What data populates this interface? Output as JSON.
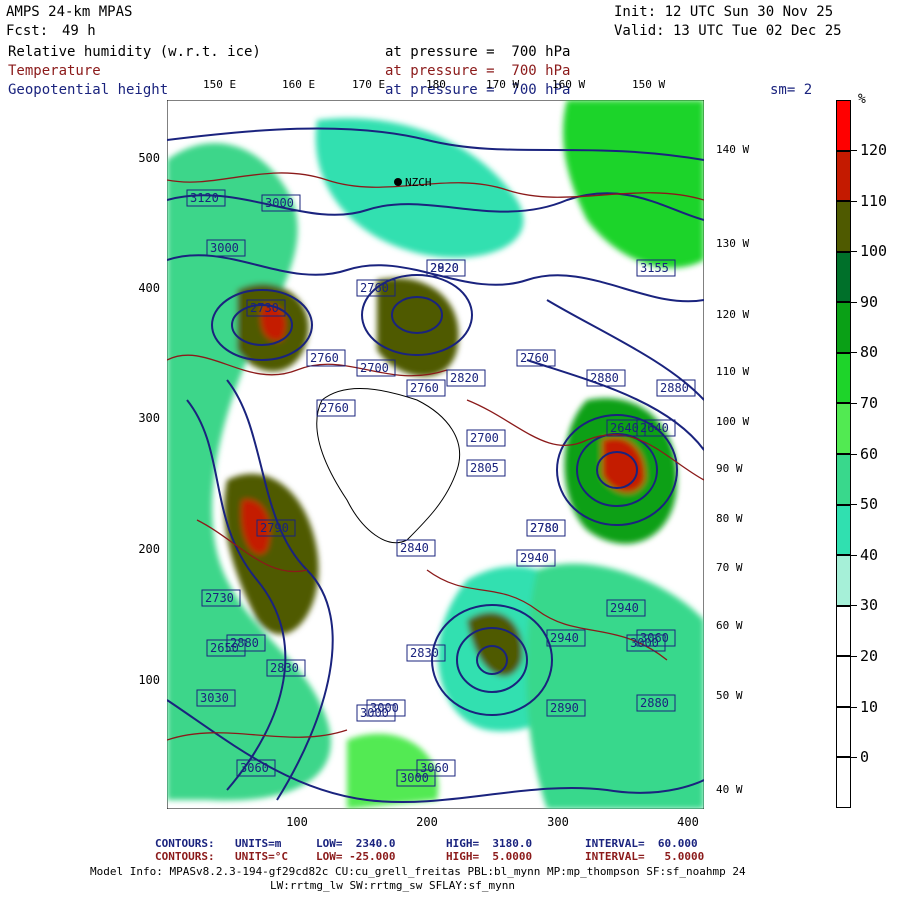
{
  "header": {
    "model": "AMPS 24-km MPAS",
    "init": "Init: 12 UTC Sun 30 Nov 25",
    "fcst_label": "Fcst:",
    "fcst_value": "49 h",
    "valid": "Valid: 13 UTC Tue 02 Dec 25"
  },
  "fields": [
    {
      "name": "Relative humidity (w.r.t. ice)",
      "level": "at pressure =  700 hPa",
      "color": "#000000"
    },
    {
      "name": "Temperature",
      "level": "at pressure =  700 hPa",
      "color": "#8b1a1a"
    },
    {
      "name": "Geopotential height",
      "level": "at pressure =  700 hPa",
      "color": "#1a237e"
    }
  ],
  "smoothing": "sm= 2",
  "colorbar": {
    "unit": "%",
    "labels": [
      "120",
      "110",
      "100",
      "90",
      "80",
      "70",
      "60",
      "50",
      "40",
      "30",
      "20",
      "10",
      "0"
    ],
    "segments": [
      "#ff0000",
      "#c41a00",
      "#4f5a00",
      "#00702a",
      "#0aa016",
      "#1ed42a",
      "#52ea52",
      "#39d88c",
      "#30e0b0",
      "#a6f0d8",
      "#ffffff",
      "#ffffff",
      "#ffffff",
      "#ffffff"
    ]
  },
  "top_lon_labels": [
    "150 E",
    "160 E",
    "170 E",
    "180",
    "170 W",
    "160 W",
    "150 W"
  ],
  "right_lon_labels": [
    "140 W",
    "130 W",
    "120 W",
    "110 W",
    "100 W",
    "90 W",
    "80 W",
    "70 W",
    "60 W",
    "50 W",
    "40 W"
  ],
  "y_ticks": [
    "500",
    "400",
    "300",
    "200",
    "100"
  ],
  "x_ticks": [
    "100",
    "200",
    "300",
    "400"
  ],
  "height_labels": [
    "3120",
    "3000",
    "3000",
    "2920",
    "2760",
    "2700",
    "2700",
    "2760",
    "2760",
    "2805",
    "2780",
    "2640",
    "2880",
    "2820",
    "2880",
    "2790",
    "2940",
    "3060",
    "3000",
    "2890",
    "2650",
    "2830",
    "3000",
    "3000",
    "2880",
    "2730",
    "3060",
    "3000",
    "2730",
    "2940",
    "3030",
    "3155",
    "2840",
    "2820",
    "2940",
    "3060",
    "2880",
    "2640",
    "2760",
    "2830",
    "2780",
    "2760"
  ],
  "station_label": "NZCH",
  "footer": {
    "c1_label": "CONTOURS:",
    "c1_units": "UNITS=m",
    "c1_low": "LOW=  2340.0",
    "c1_high": "HIGH=  3180.0",
    "c1_interval": "INTERVAL=  60.000",
    "c2_label": "CONTOURS:",
    "c2_units": "UNITS=°C",
    "c2_low": "LOW= -25.000",
    "c2_high": "HIGH=  5.0000",
    "c2_interval": "INTERVAL=   5.0000",
    "model_info_1": "Model Info: MPASv8.2.3-194-gf29cd82c CU:cu_grell_freitas PBL:bl_mynn MP:mp_thompson SF:sf_noahmp 24",
    "model_info_2": "LW:rrtmg_lw SW:rrtmg_sw SFLAY:sf_mynn"
  }
}
